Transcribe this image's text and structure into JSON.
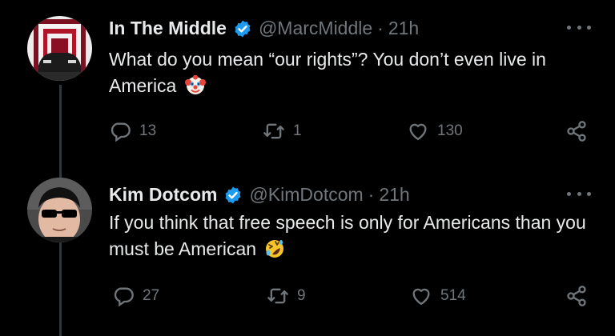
{
  "tweets": [
    {
      "display_name": "In The Middle",
      "handle": "@MarcMiddle",
      "separator": "·",
      "time": "21h",
      "text": "What do you mean “our rights”? You don’t even live in America",
      "emoji": "clown-face",
      "replies": "13",
      "reposts": "1",
      "likes": "130",
      "avatar": "car-in-neon-tunnel"
    },
    {
      "display_name": "Kim Dotcom",
      "handle": "@KimDotcom",
      "separator": "·",
      "time": "21h",
      "text": "If you think that free speech is only for Americans than you must be American",
      "emoji": "rolling-on-floor-laughing",
      "replies": "27",
      "reposts": "9",
      "likes": "514",
      "avatar": "man-with-sunglasses"
    }
  ],
  "colors": {
    "background": "#000000",
    "primary_text": "#e7e9ea",
    "secondary_text": "#71767b",
    "verified_badge": "#1d9bf0",
    "thread_line": "#333639"
  },
  "icons": {
    "reply": "reply-icon",
    "repost": "repost-icon",
    "like": "heart-icon",
    "share": "share-icon",
    "more": "more-icon",
    "verified": "verified-badge-icon"
  }
}
